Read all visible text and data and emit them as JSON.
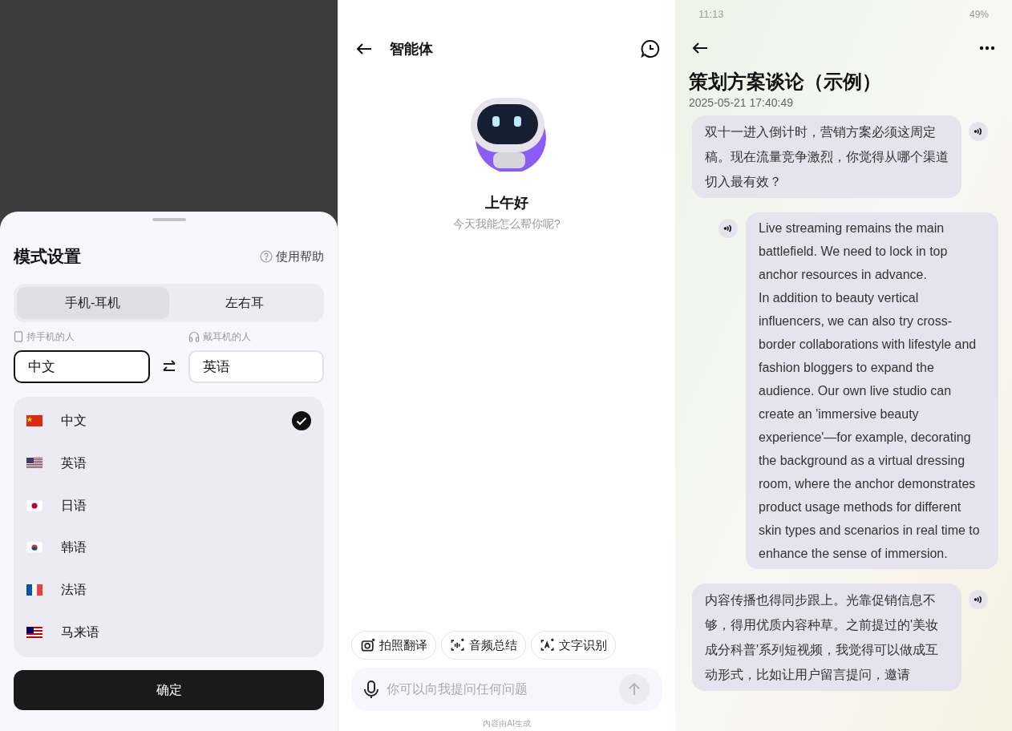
{
  "mode_sheet": {
    "title": "模式设置",
    "help": "使用帮助",
    "tabs": [
      {
        "label": "手机-耳机",
        "selected": true
      },
      {
        "label": "左右耳",
        "selected": false
      }
    ],
    "fields": [
      {
        "kind": "phone",
        "label": "持手机的人",
        "value": "中文",
        "focused": true
      },
      {
        "kind": "headphones",
        "label": "戴耳机的人",
        "value": "英语",
        "focused": false
      }
    ],
    "languages": [
      {
        "kind": "cn",
        "name": "中文",
        "selected": true
      },
      {
        "kind": "us",
        "name": "英语",
        "selected": false
      },
      {
        "kind": "jp",
        "name": "日语",
        "selected": false
      },
      {
        "kind": "kr",
        "name": "韩语",
        "selected": false
      },
      {
        "kind": "fr",
        "name": "法语",
        "selected": false
      },
      {
        "kind": "my",
        "name": "马来语",
        "selected": false
      }
    ],
    "confirm": "确定"
  },
  "agent": {
    "title": "智能体",
    "greeting": "上午好",
    "subtitle": "今天我能怎么帮你呢?",
    "chips": [
      {
        "kind": "camera",
        "label": "拍照翻译"
      },
      {
        "kind": "audio",
        "label": "音频总结"
      },
      {
        "kind": "text",
        "label": "文字识别"
      }
    ],
    "input": {
      "placeholder": "你可以向我提问任何问题"
    },
    "footer": "内容由AI生成"
  },
  "transcript": {
    "status_bar": {
      "time": "11:13",
      "battery": "49%"
    },
    "title": "策划方案谈论（示例）",
    "date": "2025-05-21 17:40:49",
    "messages": [
      {
        "indented": false,
        "paragraphs": [
          "双十一进入倒计时，营销方案必须这周定稿。现在流量竞争激烈，你觉得从哪个渠道切入最有效？"
        ]
      },
      {
        "indented": true,
        "paragraphs": [
          "Live streaming remains the main battlefield. We need to lock in top anchor resources in advance.",
          "In addition to beauty vertical influencers, we can also try cross-border collaborations with lifestyle and fashion bloggers to expand the audience. Our own live studio can create an 'immersive beauty experience'—for example, decorating the background as a virtual dressing room, where the anchor demonstrates product usage methods for different skin types and scenarios in real time to enhance the sense of immersion."
        ]
      },
      {
        "indented": false,
        "paragraphs": [
          "内容传播也得同步跟上。光靠促销信息不够，得用优质内容种草。之前提过的'美妆成分科普'系列短视频，我觉得可以做成互动形式，比如让用户留言提问，邀请"
        ]
      }
    ]
  }
}
